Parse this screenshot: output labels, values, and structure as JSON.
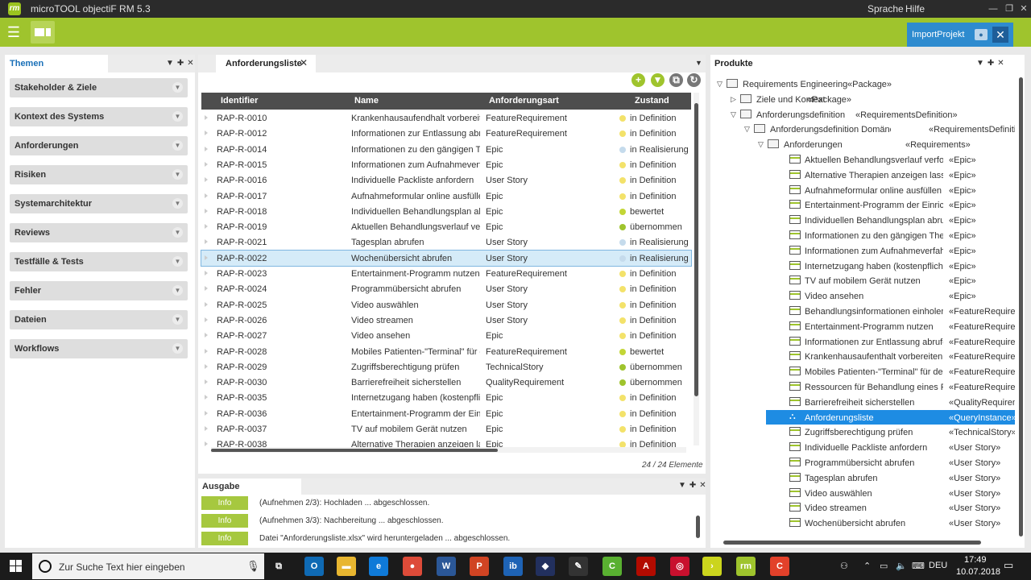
{
  "window": {
    "title": "microTOOL objectiF RM 5.3",
    "app_icon": "rm",
    "menu_sprache": "Sprache",
    "menu_hilfe": "Hilfe",
    "minimize": "—",
    "restore": "❐",
    "close": "✕"
  },
  "toolbar": {
    "menu_icon": "☰",
    "import_project": "ImportProjekt",
    "import_view_icon": "eye-icon",
    "import_close": "✕"
  },
  "left_panel": {
    "title": "Themen",
    "items": [
      "Stakeholder & Ziele",
      "Kontext des Systems",
      "Anforderungen",
      "Risiken",
      "Systemarchitektur",
      "Reviews",
      "Testfälle & Tests",
      "Fehler",
      "Dateien",
      "Workflows"
    ]
  },
  "center": {
    "tab_title": "Anforderungsliste",
    "tab_close": "✕",
    "columns": [
      "Identifier",
      "Name",
      "Anforderungsart",
      "Zustand"
    ],
    "rows": [
      {
        "id": "RAP-R-0010",
        "name": "Krankenhausaufendhalt vorbereiten",
        "type": "FeatureRequirement",
        "state": "in Definition",
        "color": "#f3e26a"
      },
      {
        "id": "RAP-R-0012",
        "name": "Informationen zur Entlassung abrufen",
        "type": "FeatureRequirement",
        "state": "in Definition",
        "color": "#f3e26a"
      },
      {
        "id": "RAP-R-0014",
        "name": "Informationen zu den gängigen Therapien",
        "type": "Epic",
        "state": "in Realisierung",
        "color": "#c5dbec"
      },
      {
        "id": "RAP-R-0015",
        "name": "Informationen zum Aufnahmeverfahren",
        "type": "Epic",
        "state": "in Definition",
        "color": "#f3e26a"
      },
      {
        "id": "RAP-R-0016",
        "name": "Individuelle Packliste anfordern",
        "type": "User Story",
        "state": "in Definition",
        "color": "#f3e26a"
      },
      {
        "id": "RAP-R-0017",
        "name": "Aufnahmeformular online ausfüllen",
        "type": "Epic",
        "state": "in Definition",
        "color": "#f3e26a"
      },
      {
        "id": "RAP-R-0018",
        "name": "Individuellen Behandlungsplan abrufen",
        "type": "Epic",
        "state": "bewertet",
        "color": "#c3d636"
      },
      {
        "id": "RAP-R-0019",
        "name": "Aktuellen Behandlungsverlauf verfolgen",
        "type": "Epic",
        "state": "übernommen",
        "color": "#9fc42d"
      },
      {
        "id": "RAP-R-0021",
        "name": "Tagesplan abrufen",
        "type": "User Story",
        "state": "in Realisierung",
        "color": "#c5dbec"
      },
      {
        "id": "RAP-R-0022",
        "name": "Wochenübersicht abrufen",
        "type": "User Story",
        "state": "in Realisierung",
        "color": "#c5dbec"
      },
      {
        "id": "RAP-R-0023",
        "name": "Entertainment-Programm nutzen",
        "type": "FeatureRequirement",
        "state": "in Definition",
        "color": "#f3e26a"
      },
      {
        "id": "RAP-R-0024",
        "name": "Programmübersicht abrufen",
        "type": "User Story",
        "state": "in Definition",
        "color": "#f3e26a"
      },
      {
        "id": "RAP-R-0025",
        "name": "Video auswählen",
        "type": "User Story",
        "state": "in Definition",
        "color": "#f3e26a"
      },
      {
        "id": "RAP-R-0026",
        "name": "Video streamen",
        "type": "User Story",
        "state": "in Definition",
        "color": "#f3e26a"
      },
      {
        "id": "RAP-R-0027",
        "name": "Video ansehen",
        "type": "Epic",
        "state": "in Definition",
        "color": "#f3e26a"
      },
      {
        "id": "RAP-R-0028",
        "name": "Mobiles Patienten-\"Terminal\" für den",
        "type": "FeatureRequirement",
        "state": "bewertet",
        "color": "#c3d636"
      },
      {
        "id": "RAP-R-0029",
        "name": "Zugriffsberechtigung prüfen",
        "type": "TechnicalStory",
        "state": "übernommen",
        "color": "#9fc42d"
      },
      {
        "id": "RAP-R-0030",
        "name": "Barrierefreiheit sicherstellen",
        "type": "QualityRequirement",
        "state": "übernommen",
        "color": "#9fc42d"
      },
      {
        "id": "RAP-R-0035",
        "name": "Internetzugang haben (kostenpflichtig)",
        "type": "Epic",
        "state": "in Definition",
        "color": "#f3e26a"
      },
      {
        "id": "RAP-R-0036",
        "name": "Entertainment-Programm  der Einrichtung",
        "type": "Epic",
        "state": "in Definition",
        "color": "#f3e26a"
      },
      {
        "id": "RAP-R-0037",
        "name": "TV auf mobilem Gerät nutzen",
        "type": "Epic",
        "state": "in Definition",
        "color": "#f3e26a"
      },
      {
        "id": "RAP-R-0038",
        "name": "Alternative Therapien anzeigen lassen",
        "type": "Epic",
        "state": "in Definition",
        "color": "#f3e26a"
      }
    ],
    "selected_row_index": 9,
    "count_text": "24 / 24 Elemente"
  },
  "output": {
    "title": "Ausgabe",
    "logs": [
      {
        "level": "Info",
        "text": "(Aufnehmen 2/3): Hochladen ...  abgeschlossen."
      },
      {
        "level": "Info",
        "text": "(Aufnehmen 3/3): Nachbereitung ...  abgeschlossen."
      },
      {
        "level": "Info",
        "text": "Datei \"Anforderungsliste.xlsx\" wird heruntergeladen ...  abgeschlossen."
      }
    ]
  },
  "right_panel": {
    "title": "Produkte",
    "tree": [
      {
        "level": 0,
        "toggle": "▽",
        "icon": "folder",
        "name": "Requirements Engineering",
        "stereo": "«Package»"
      },
      {
        "level": 1,
        "toggle": "▷",
        "icon": "folder",
        "name": "Ziele und Kontext",
        "stereo": "«Package»"
      },
      {
        "level": 1,
        "toggle": "▽",
        "icon": "folder",
        "name": "Anforderungsdefinition",
        "stereo": "«RequirementsDefinition»"
      },
      {
        "level": 2,
        "toggle": "▽",
        "icon": "folder",
        "name": "Anforderungsdefinition Domäne",
        "stereo": "«RequirementsDefinition»"
      },
      {
        "level": 3,
        "toggle": "▽",
        "icon": "folder",
        "name": "Anforderungen",
        "stereo": "«Requirements»"
      },
      {
        "level": 4,
        "icon": "req",
        "name": "Aktuellen Behandlungsverlauf verfolg...",
        "stereo": "«Epic»"
      },
      {
        "level": 4,
        "icon": "req",
        "name": "Alternative Therapien anzeigen lassen",
        "stereo": "«Epic»"
      },
      {
        "level": 4,
        "icon": "req",
        "name": "Aufnahmeformular online ausfüllen",
        "stereo": "«Epic»"
      },
      {
        "level": 4,
        "icon": "req",
        "name": "Entertainment-Programm  der Einrich...",
        "stereo": "«Epic»"
      },
      {
        "level": 4,
        "icon": "req",
        "name": "Individuellen Behandlungsplan abrufen",
        "stereo": "«Epic»"
      },
      {
        "level": 4,
        "icon": "req",
        "name": "Informationen zu den gängigen Thera...",
        "stereo": "«Epic»"
      },
      {
        "level": 4,
        "icon": "req",
        "name": "Informationen zum Aufnahmeverfah...",
        "stereo": "«Epic»"
      },
      {
        "level": 4,
        "icon": "req",
        "name": "Internetzugang haben (kostenpflichtig)",
        "stereo": "«Epic»"
      },
      {
        "level": 4,
        "icon": "req",
        "name": "TV auf mobilem Gerät nutzen",
        "stereo": "«Epic»"
      },
      {
        "level": 4,
        "icon": "req",
        "name": "Video ansehen",
        "stereo": "«Epic»"
      },
      {
        "level": 4,
        "icon": "req",
        "name": "Behandlungsinformationen einholen",
        "stereo": "«FeatureRequirement»"
      },
      {
        "level": 4,
        "icon": "req",
        "name": "Entertainment-Programm nutzen",
        "stereo": "«FeatureRequirement»"
      },
      {
        "level": 4,
        "icon": "req",
        "name": "Informationen zur Entlassung abrufen",
        "stereo": "«FeatureRequirement»"
      },
      {
        "level": 4,
        "icon": "req",
        "name": "Krankenhausaufenthalt vorbereiten (...",
        "stereo": "«FeatureRequirement»"
      },
      {
        "level": 4,
        "icon": "req",
        "name": "Mobiles Patienten-\"Terminal\" für den...",
        "stereo": "«FeatureRequirement»"
      },
      {
        "level": 4,
        "icon": "req",
        "name": "Ressourcen für Behandlung eines Pati...",
        "stereo": "«FeatureRequirement»"
      },
      {
        "level": 4,
        "icon": "req",
        "name": "Barrierefreiheit sicherstellen",
        "stereo": "«QualityRequirement»"
      },
      {
        "level": 4,
        "icon": "query",
        "name": "Anforderungsliste",
        "stereo": "«QueryInstance»",
        "selected": true
      },
      {
        "level": 4,
        "icon": "req",
        "name": "Zugriffsberechtigung prüfen",
        "stereo": "«TechnicalStory»"
      },
      {
        "level": 4,
        "icon": "req",
        "name": "Individuelle Packliste anfordern",
        "stereo": "«User Story»"
      },
      {
        "level": 4,
        "icon": "req",
        "name": "Programmübersicht abrufen",
        "stereo": "«User Story»"
      },
      {
        "level": 4,
        "icon": "req",
        "name": "Tagesplan abrufen",
        "stereo": "«User Story»"
      },
      {
        "level": 4,
        "icon": "req",
        "name": "Video auswählen",
        "stereo": "«User Story»"
      },
      {
        "level": 4,
        "icon": "req",
        "name": "Video streamen",
        "stereo": "«User Story»"
      },
      {
        "level": 4,
        "icon": "req",
        "name": "Wochenübersicht abrufen",
        "stereo": "«User Story»"
      }
    ]
  },
  "taskbar": {
    "search_placeholder": "Zur Suche Text hier eingeben",
    "apps": [
      {
        "name": "task-view-icon",
        "label": "⧉",
        "color": "transparent"
      },
      {
        "name": "outlook-icon",
        "label": "O",
        "color": "#0f6ab4"
      },
      {
        "name": "file-explorer-icon",
        "label": "▬",
        "color": "#e8b630"
      },
      {
        "name": "edge-icon",
        "label": "e",
        "color": "#0f7ad8"
      },
      {
        "name": "chrome-icon",
        "label": "●",
        "color": "#dd4b39"
      },
      {
        "name": "word-icon",
        "label": "W",
        "color": "#2b5797"
      },
      {
        "name": "powerpoint-icon",
        "label": "P",
        "color": "#d04423"
      },
      {
        "name": "ib-icon",
        "label": "ib",
        "color": "#1e63b5"
      },
      {
        "name": "app-blue-icon",
        "label": "◆",
        "color": "#22305e"
      },
      {
        "name": "tools-icon",
        "label": "✎",
        "color": "#333"
      },
      {
        "name": "camtasia-icon",
        "label": "C",
        "color": "#59b031"
      },
      {
        "name": "acrobat-icon",
        "label": "A",
        "color": "#b30b00"
      },
      {
        "name": "app-red-icon",
        "label": "◎",
        "color": "#c8102e"
      },
      {
        "name": "app-next-icon",
        "label": "›",
        "color": "#cbd51d"
      },
      {
        "name": "objectif-rm-icon",
        "label": "rm",
        "color": "#9fc42d"
      },
      {
        "name": "app-snagit-icon",
        "label": "C",
        "color": "#e2412a"
      }
    ],
    "language": "DEU",
    "time": "17:49",
    "date": "10.07.2018"
  }
}
